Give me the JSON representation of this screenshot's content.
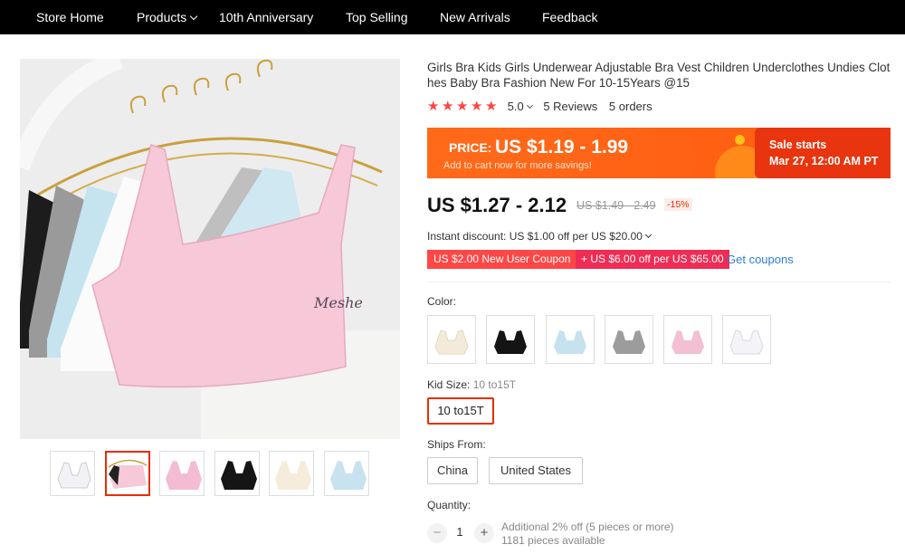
{
  "nav": {
    "store_home": "Store Home",
    "products": "Products",
    "anniversary": "10th Anniversary",
    "top_selling": "Top Selling",
    "new_arrivals": "New Arrivals",
    "feedback": "Feedback"
  },
  "product": {
    "title": "Girls Bra Kids Girls Underwear Adjustable Bra Vest Children Underclothes Undies Clothes Baby Bra Fashion New For 10-15Years @15",
    "rating": "5.0",
    "reviews": "5 Reviews",
    "orders": "5 orders",
    "price_label": "PRICE:",
    "price_range": "US $1.19 - 1.99",
    "price_sub": "Add to cart now for more savings!",
    "sale_title": "Sale starts",
    "sale_date": "Mar 27, 12:00 AM PT",
    "current_price": "US $1.27 - 2.12",
    "old_price": "US $1.49 - 2.49",
    "discount": "-15%",
    "instant_discount": "Instant discount: US $1.00 off per US $20.00",
    "coupon_new_user": "US $2.00 New User Coupon",
    "coupon_off": "+ US $6.00 off per US $65.00",
    "get_coupons": "Get coupons",
    "color_label": "Color:",
    "kid_size_label": "Kid Size:",
    "kid_size_value": "10 to15T",
    "size_option": "10 to15T",
    "ships_from_label": "Ships From:",
    "ship_china": "China",
    "ship_us": "United States",
    "quantity_label": "Quantity:",
    "quantity": "1",
    "minus": "−",
    "plus": "+",
    "additional_off": "Additional 2% off (5 pieces or more)",
    "available": "1181 pieces available"
  },
  "swatch_colors": [
    "beige",
    "black",
    "light-blue",
    "gray",
    "pink",
    "white"
  ],
  "colors": {
    "nav_bg": "#000000",
    "accent_red": "#e62e04",
    "banner_orange": "#ff6a1a",
    "star": "#ff4747",
    "link_blue": "#2e7dd7"
  }
}
